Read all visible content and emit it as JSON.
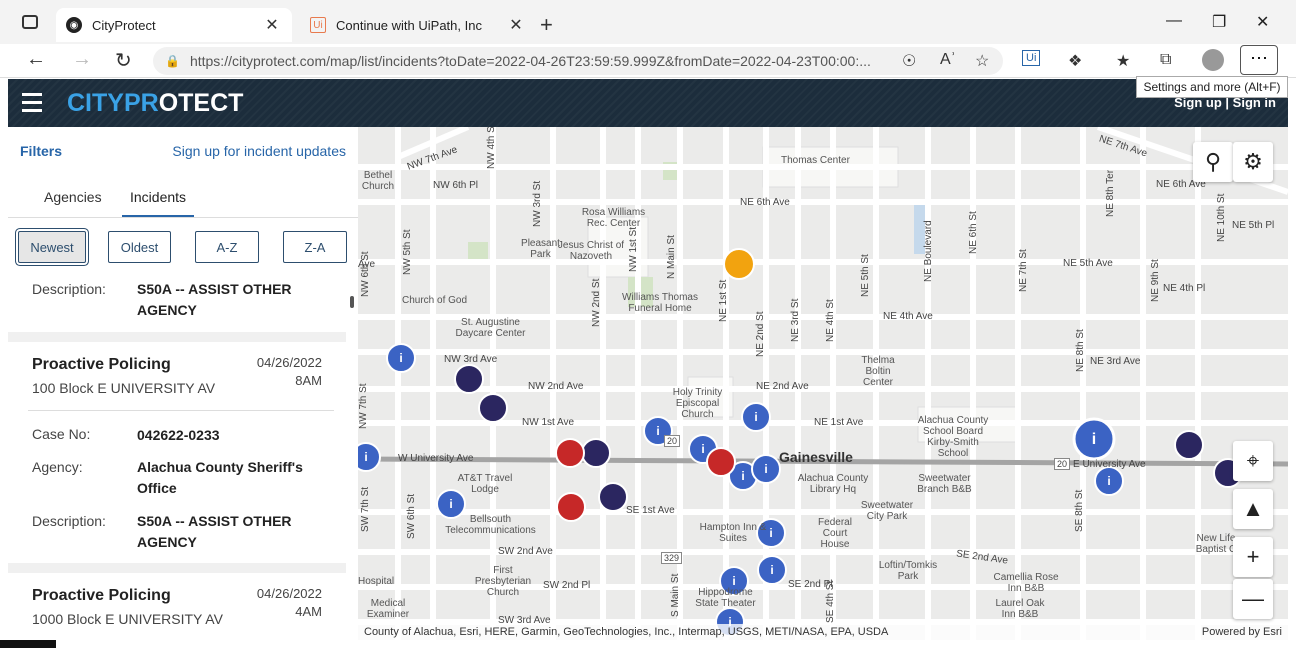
{
  "browser": {
    "tabs": [
      {
        "title": "CityProtect",
        "active": true
      },
      {
        "title": "Continue with UiPath, Inc",
        "active": false
      }
    ],
    "url": "https://cityprotect.com/map/list/incidents?toDate=2022-04-26T23:59:59.999Z&fromDate=2022-04-23T00:00:...",
    "settings_tooltip": "Settings and more (Alt+F)",
    "reading_label": "Aʾ",
    "uipath_label": "Ui"
  },
  "app": {
    "logo_a": "CITYPR",
    "logo_b": "O",
    "logo_c": "TECT",
    "auth_links": "Sign up | Sign in"
  },
  "panel": {
    "filters_label": "Filters",
    "signup_updates_label": "Sign up for incident updates",
    "tabs": [
      "Agencies",
      "Incidents"
    ],
    "active_tab": "Incidents",
    "sort_buttons": [
      "Newest",
      "Oldest",
      "A-Z",
      "Z-A"
    ],
    "selected_sort": "Newest",
    "labels": {
      "case": "Case No:",
      "agency": "Agency:",
      "description": "Description:"
    },
    "partial_card": {
      "description": "S50A -- ASSIST OTHER AGENCY"
    },
    "incidents": [
      {
        "title": "Proactive Policing",
        "address": "100 Block E UNIVERSITY AV",
        "date": "04/26/2022",
        "time": "8AM",
        "case_no": "042622-0233",
        "agency": "Alachua County Sheriff's Office",
        "description": "S50A -- ASSIST OTHER AGENCY"
      },
      {
        "title": "Proactive Policing",
        "address": "1000 Block E UNIVERSITY AV",
        "date": "04/26/2022",
        "time": "4AM"
      }
    ]
  },
  "map": {
    "city_label": "Gainesville",
    "attribution": "County of Alachua, Esri, HERE, Garmin, GeoTechnologies, Inc., Intermap, USGS, METI/NASA, EPA, USDA",
    "powered_by": "Powered by Esri",
    "route_shields": [
      "20",
      "20",
      "329"
    ],
    "places": [
      "Thomas Center",
      "Rosa Williams Rec. Center",
      "Pleasant Park",
      "Jesus Christ of Nazoveth",
      "Church of God",
      "St. Augustine Daycare Center",
      "Williams Thomas Funeral Home",
      "Holy Trinity Episcopal Church",
      "Thelma Boltin Center",
      "Alachua County School Board Kirby-Smith School",
      "AT&T Travel Lodge",
      "Bellsouth Telecommunications",
      "Hampton Inn & Suites",
      "Alachua County Library Hq",
      "Sweetwater Branch B&B",
      "Sweetwater City Park",
      "Federal Court House",
      "Loftin/Tomkis Park",
      "First Presbyterian Church",
      "Hippodrome State Theater",
      "Camellia Rose Inn B&B",
      "Laurel Oak Inn B&B",
      "Medical Examiner",
      "Hospital",
      "New Life Baptist C",
      "Bethel Church"
    ],
    "streets": [
      "NW 7th Ave",
      "NW 6th Pl",
      "NE 6th Ave",
      "NE 5th Ave",
      "NE 4th Ave",
      "NE 4th Pl",
      "NE 3rd Ave",
      "NW 3rd Ave",
      "NE 2nd Ave",
      "NW 2nd Ave",
      "NW 1st Ave",
      "NE 1st Ave",
      "W University Ave",
      "E University Ave",
      "SE 1st Ave",
      "SW 2nd Ave",
      "SE 2nd Ave",
      "SW 2nd Pl",
      "SE 2nd Pl",
      "SW 3rd Ave",
      "NE 7th Ave",
      "NE 6th Ave",
      "NE 5th Pl",
      "NW 5th St",
      "NW 4th St",
      "NW 3rd St",
      "NW 2nd St",
      "NW 1st St",
      "N Main St",
      "NE 1st St",
      "NE 2nd St",
      "NE 3rd St",
      "NE 4th St",
      "NE 5th St",
      "NE 6th St",
      "NE 7th St",
      "NE 8th St",
      "NE 9th St",
      "NE 10th St",
      "NE Boulevard",
      "NE 8th Ter",
      "NW 6th St",
      "NW 7th St",
      "SW 7th St",
      "SW 6th St",
      "S Main St",
      "SE 8th St",
      "SE 4th St",
      "Ave"
    ]
  },
  "colors": {
    "header_bg": "#1c2d3c",
    "link_blue": "#2765a8",
    "logo_accent": "#3aa2e6",
    "info_marker": "#3b63c4",
    "drug_marker": "#2b2660",
    "assault_marker": "#c62828",
    "burglary_marker": "#f2a30f"
  }
}
